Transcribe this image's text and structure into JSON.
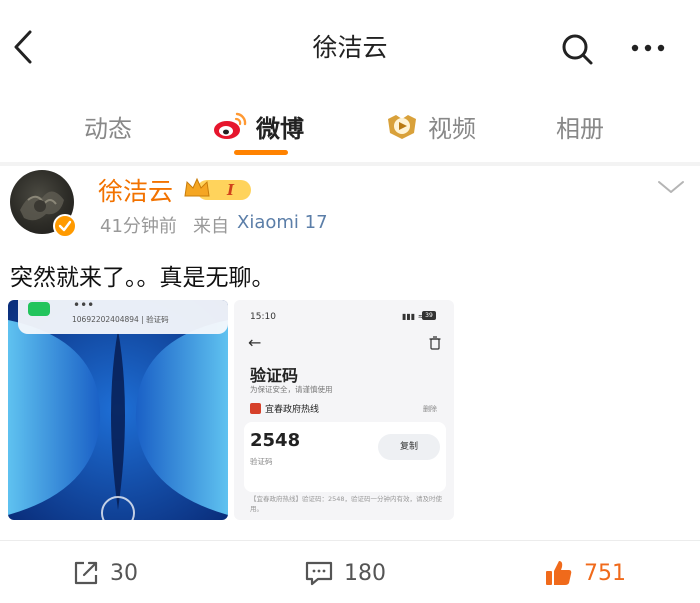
{
  "header": {
    "title": "徐洁云",
    "back_icon": "chevron-left-icon",
    "search_icon": "search-icon",
    "more_icon": "more-dots-icon"
  },
  "tabs": [
    {
      "label": "动态",
      "active": false
    },
    {
      "label": "微博",
      "active": true,
      "icon": "weibo-logo-icon"
    },
    {
      "label": "视频",
      "active": false,
      "icon": "video-badge-icon"
    },
    {
      "label": "相册",
      "active": false
    }
  ],
  "accent_color": "#ff8200",
  "post": {
    "author": "徐洁云",
    "vip_level": "I",
    "time": "41分钟前",
    "source_prefix": "来自",
    "source": "Xiaomi 17",
    "text": "突然就来了。。真是无聊。",
    "images": [
      {
        "notification_dots": "•••",
        "notification_text": "10692202404894 | 验证码"
      },
      {
        "status_time": "15:10",
        "status_icons": "▮▮▮ ≈",
        "battery": "39",
        "title": "验证码",
        "subtitle": "为保证安全，请谨慎使用",
        "sender": "宜春政府热线",
        "cancel_label": "删除",
        "code": "2548",
        "code_label": "验证码",
        "copy_label": "复制",
        "message": "【宜春政府热线】验证码：2548，验证码一分钟内有效，请及时使用。"
      }
    ]
  },
  "actions": {
    "repost_count": "30",
    "comment_count": "180",
    "like_count": "751"
  }
}
